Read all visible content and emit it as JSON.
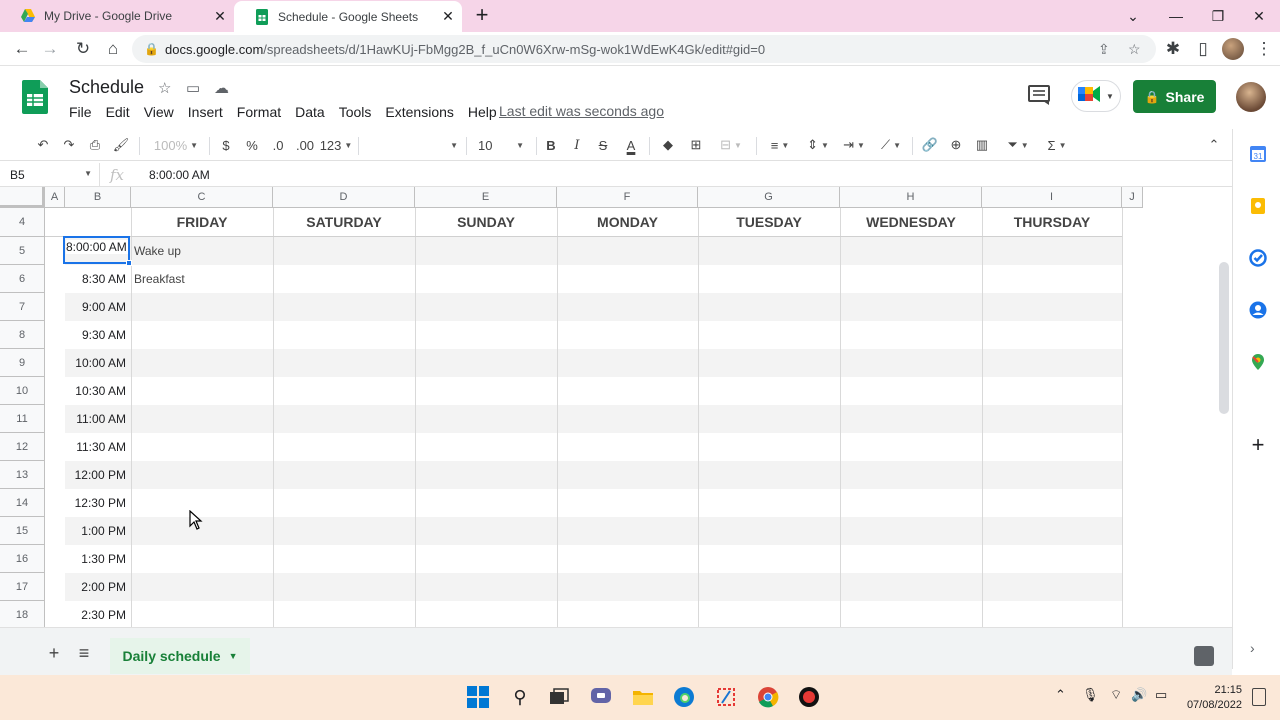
{
  "browser": {
    "tabs": [
      {
        "title": "My Drive - Google Drive",
        "active": false
      },
      {
        "title": "Schedule - Google Sheets",
        "active": true
      }
    ],
    "url_host": "docs.google.com",
    "url_path": "/spreadsheets/d/1HawKUj-FbMgg2B_f_uCn0W6Xrw-mSg-wok1WdEwK4Gk/edit#gid=0"
  },
  "sheets": {
    "doc_title": "Schedule",
    "menu": [
      "File",
      "Edit",
      "View",
      "Insert",
      "Format",
      "Data",
      "Tools",
      "Extensions",
      "Help"
    ],
    "last_edit": "Last edit was seconds ago",
    "share_label": "Share",
    "brand_color": "#188038",
    "selection_color": "#1a73e8"
  },
  "toolbar": {
    "zoom": "100%",
    "currency": "$",
    "percent": "%",
    "decimal_decrease": ".0",
    "decimal_increase": ".00",
    "more_formats": "123",
    "font_size": "10",
    "bold": "B",
    "italic": "I",
    "strike": "S",
    "text_color": "A"
  },
  "formula_bar": {
    "cell_ref": "B5",
    "fx": "fx",
    "value": "8:00:00 AM"
  },
  "grid": {
    "columns": [
      "A",
      "B",
      "C",
      "D",
      "E",
      "F",
      "G",
      "H",
      "I",
      "J"
    ],
    "days": [
      "FRIDAY",
      "SATURDAY",
      "SUNDAY",
      "MONDAY",
      "TUESDAY",
      "WEDNESDAY",
      "THURSDAY"
    ],
    "header_row": "4",
    "rows": [
      {
        "row": "5",
        "time": "8:00:00 AM",
        "task": "Wake up"
      },
      {
        "row": "6",
        "time": "8:30 AM",
        "task": "Breakfast"
      },
      {
        "row": "7",
        "time": "9:00 AM",
        "task": ""
      },
      {
        "row": "8",
        "time": "9:30 AM",
        "task": ""
      },
      {
        "row": "9",
        "time": "10:00 AM",
        "task": ""
      },
      {
        "row": "10",
        "time": "10:30 AM",
        "task": ""
      },
      {
        "row": "11",
        "time": "11:00 AM",
        "task": ""
      },
      {
        "row": "12",
        "time": "11:30 AM",
        "task": ""
      },
      {
        "row": "13",
        "time": "12:00 PM",
        "task": ""
      },
      {
        "row": "14",
        "time": "12:30 PM",
        "task": ""
      },
      {
        "row": "15",
        "time": "1:00 PM",
        "task": ""
      },
      {
        "row": "16",
        "time": "1:30 PM",
        "task": ""
      },
      {
        "row": "17",
        "time": "2:00 PM",
        "task": ""
      },
      {
        "row": "18",
        "time": "2:30 PM",
        "task": ""
      }
    ]
  },
  "sheet_tabs": {
    "active": "Daily schedule"
  },
  "taskbar": {
    "time": "21:15",
    "date": "07/08/2022"
  }
}
